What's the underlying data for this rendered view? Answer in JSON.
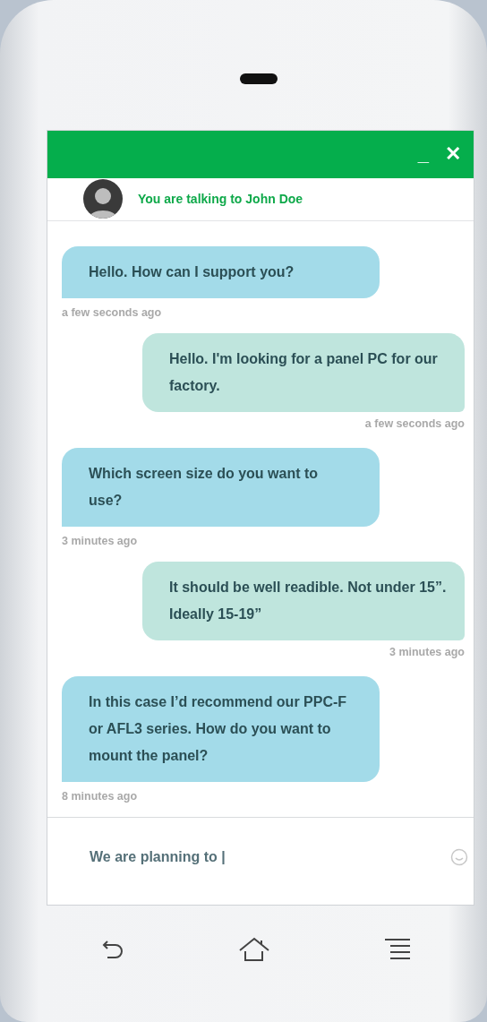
{
  "header": {
    "controls": [
      "_",
      "✕"
    ]
  },
  "agent": {
    "text": "You are talking to John Doe"
  },
  "messages": [
    {
      "kind": "agent",
      "text": "Hello. How can I support you?",
      "time": "a few seconds ago"
    },
    {
      "kind": "user",
      "text": "Hello. I'm looking for a panel PC for our factory.",
      "time": "a few seconds ago"
    },
    {
      "kind": "agent",
      "text": "Which screen size do you want to use?",
      "time": "3 minutes ago"
    },
    {
      "kind": "user",
      "text": "It should be well readible. Not under 15”. Ideally 15-19”",
      "time": "3 minutes ago"
    },
    {
      "kind": "agent",
      "text": "In this case I’d recommend our PPC-F or AFL3 series. How do you want to mount the panel?",
      "time": "8 minutes ago"
    }
  ],
  "input": {
    "value": "We are planning to |"
  }
}
